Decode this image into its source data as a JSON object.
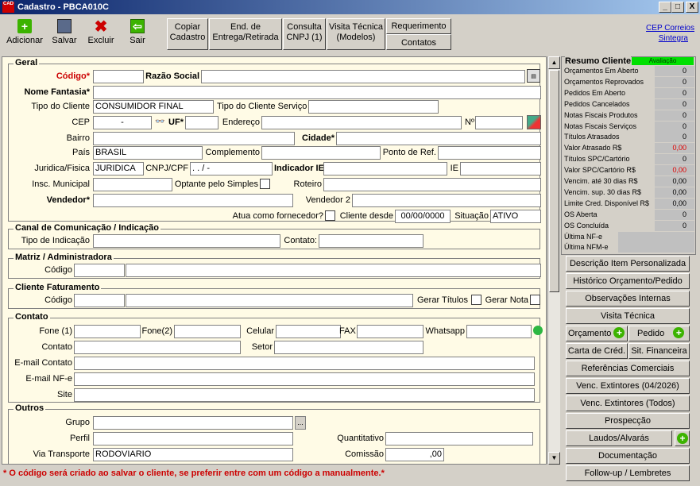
{
  "window": {
    "title": "Cadastro - PBCA010C",
    "logo": "CAD",
    "min": "_",
    "max": "□",
    "close": "X"
  },
  "toolbar": {
    "adicionar": "Adicionar",
    "salvar": "Salvar",
    "excluir": "Excluir",
    "sair": "Sair"
  },
  "actions": {
    "copiar": "Copiar Cadastro",
    "end": "End. de Entrega/Retirada",
    "cnpj": "Consulta CNPJ (1)",
    "visita": "Visita Técnica (Modelos)",
    "requerimento": "Requerimento",
    "contatos": "Contatos"
  },
  "links": {
    "cep": "CEP Correios",
    "sintegra": "Sintegra"
  },
  "geral": {
    "title": "Geral",
    "codigo": "Código*",
    "razao": "Razão Social",
    "fantasia": "Nome Fantasia*",
    "tipo_cliente": "Tipo do Cliente",
    "tipo_cliente_val": "CONSUMIDOR FINAL",
    "tipo_servico": "Tipo do Cliente Serviço",
    "cep": "CEP",
    "cep_val": "-",
    "uf": "UF*",
    "endereco": "Endereço",
    "numero": "Nº",
    "bairro": "Bairro",
    "cidade": "Cidade*",
    "pais": "País",
    "pais_val": "BRASIL",
    "complemento": "Complemento",
    "ponto": "Ponto de Ref.",
    "juridica": "Juridica/Fisica",
    "juridica_val": "JURIDICA",
    "cnpj": "CNPJ/CPF",
    "cnpj_val": " .  .  /  -",
    "indicador": "Indicador IE*",
    "ie": "IE",
    "insc": "Insc. Municipal",
    "optante": "Optante pelo Simples",
    "roteiro": "Roteiro",
    "vendedor": "Vendedor*",
    "vendedor2": "Vendedor 2",
    "fornecedor": "Atua como fornecedor?",
    "cliente_desde": "Cliente desde",
    "cliente_desde_val": "00/00/0000",
    "situacao": "Situação",
    "situacao_val": "ATIVO"
  },
  "canal": {
    "title": "Canal de Comunicação / Indicação",
    "tipo": "Tipo de Indicação",
    "contato": "Contato:"
  },
  "matriz": {
    "title": "Matriz / Administradora",
    "codigo": "Código"
  },
  "faturamento": {
    "title": "Cliente Faturamento",
    "codigo": "Código",
    "gerar_titulos": "Gerar Títulos",
    "gerar_nota": "Gerar Nota"
  },
  "contato": {
    "title": "Contato",
    "fone1": "Fone (1)",
    "fone2": "Fone(2)",
    "celular": "Celular",
    "fax": "FAX",
    "whatsapp": "Whatsapp",
    "contato": "Contato",
    "setor": "Setor",
    "email": "E-mail Contato",
    "email_nfe": "E-mail NF-e",
    "site": "Site"
  },
  "outros": {
    "title": "Outros",
    "grupo": "Grupo",
    "perfil": "Perfil",
    "quantitativo": "Quantitativo",
    "via": "Via Transporte",
    "via_val": "RODOVIARIO",
    "comissao": "Comissão",
    "comissao_val": ",00",
    "ellipsis": "..."
  },
  "footer": "* O código será criado ao salvar o cliente, se preferir entre com um código a manualmente.*",
  "resumo": {
    "title": "Resumo Cliente",
    "avaliacao": "Avaliação",
    "rows": [
      {
        "k": "Orçamentos Em Aberto",
        "v": "0"
      },
      {
        "k": "Orçamentos Reprovados",
        "v": "0"
      },
      {
        "k": "Pedidos Em Aberto",
        "v": "0"
      },
      {
        "k": "Pedidos Cancelados",
        "v": "0"
      },
      {
        "k": "Notas Fiscais Produtos",
        "v": "0"
      },
      {
        "k": "Notas Fiscais Serviços",
        "v": "0"
      },
      {
        "k": "Títulos Atrasados",
        "v": "0"
      },
      {
        "k": "Valor Atrasado R$",
        "v": "0,00"
      },
      {
        "k": "Títulos SPC/Cartório",
        "v": "0"
      },
      {
        "k": "Valor SPC/Cartório R$",
        "v": "0,00"
      },
      {
        "k": "Vencim. até 30 dias R$",
        "v": "0,00"
      },
      {
        "k": "Vencim. sup. 30 dias R$",
        "v": "0,00"
      },
      {
        "k": "Limite Cred. Disponível R$",
        "v": "0,00"
      },
      {
        "k": "OS Aberta",
        "v": "0"
      },
      {
        "k": "OS Concluída",
        "v": "0"
      },
      {
        "k": "Última NF-e",
        "v": ""
      },
      {
        "k": "Última NFM-e",
        "v": ""
      }
    ]
  },
  "side": {
    "descricao": "Descrição Item Personalizada",
    "historico": "Histórico Orçamento/Pedido",
    "obs": "Observações Internas",
    "visita": "Visita Técnica",
    "orcamento": "Orçamento",
    "pedido": "Pedido",
    "carta": "Carta de Créd.",
    "sit": "Sit. Financeira",
    "referencias": "Referências Comerciais",
    "venc1": "Venc. Extintores (04/2026)",
    "venc2": "Venc. Extintores (Todos)",
    "prospeccao": "Prospecção",
    "laudos": "Laudos/Alvarás",
    "doc": "Documentação",
    "follow": "Follow-up / Lembretes"
  },
  "colors": {
    "title_start": "#0a246a",
    "accent_red": "#cc0000",
    "green": "#3cb300",
    "form_bg": "#fffbe6"
  }
}
